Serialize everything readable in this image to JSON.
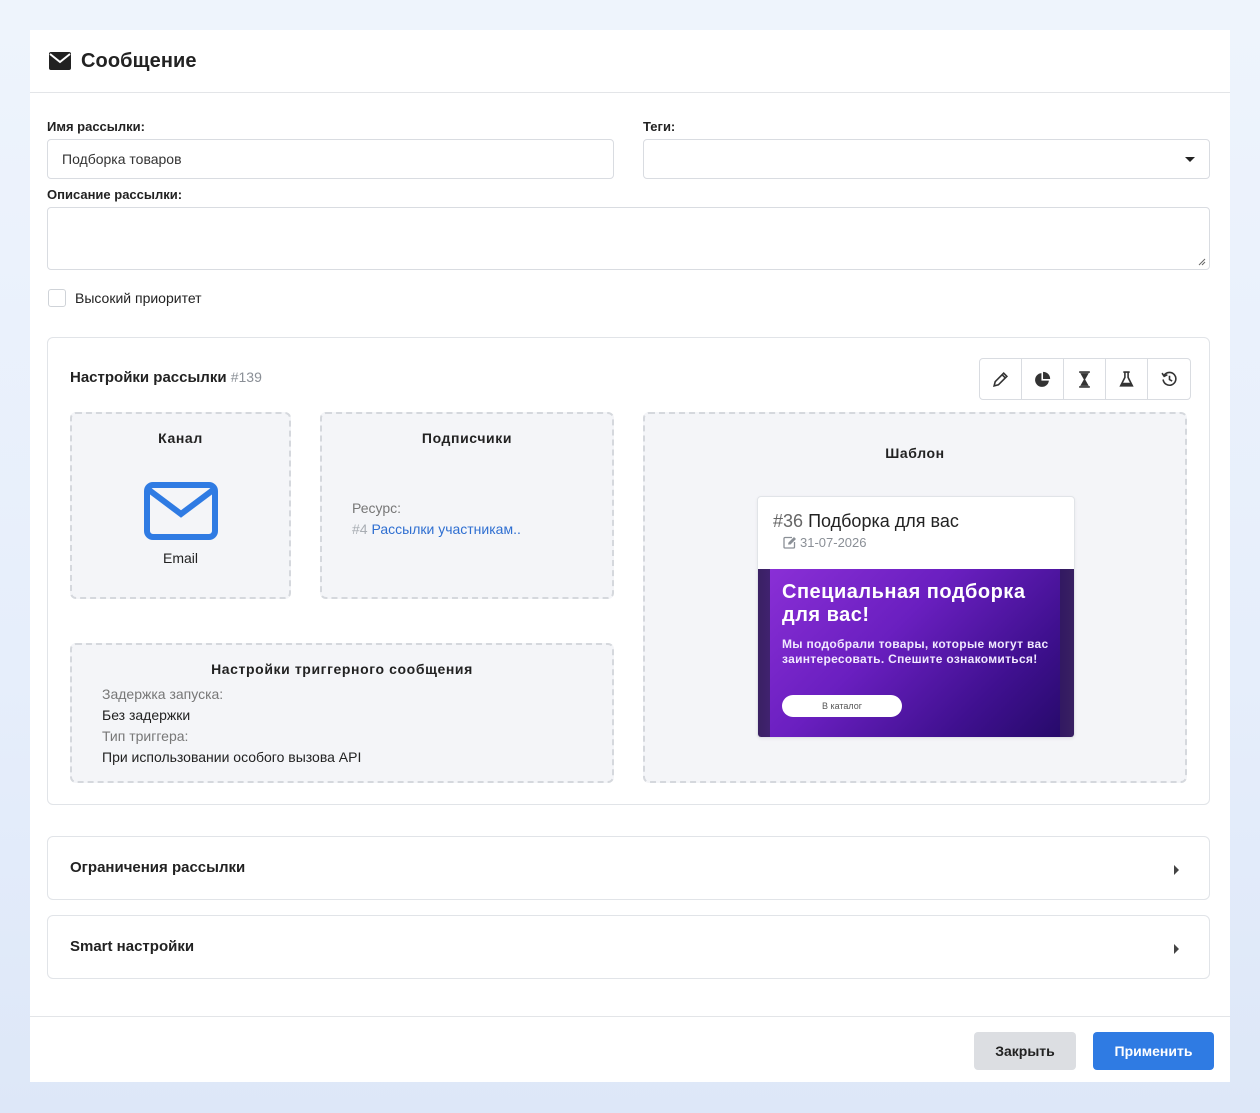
{
  "modal": {
    "title": "Сообщение",
    "title_icon": "envelope-icon"
  },
  "form": {
    "name_label": "Имя рассылки:",
    "name_value": "Подборка товаров",
    "tags_label": "Теги:",
    "tags_value": "",
    "description_label": "Описание рассылки:",
    "description_value": "",
    "priority_label": "Высокий приоритет",
    "priority_checked": false
  },
  "settings": {
    "title": "Настройки рассылки",
    "id": "#139",
    "toolbar": [
      "pencil-icon",
      "pie-chart-icon",
      "hourglass-icon",
      "flask-icon",
      "history-icon"
    ],
    "channel": {
      "title": "Канал",
      "name": "Email",
      "icon": "email-icon",
      "icon_color": "#2f7be3"
    },
    "subscribers": {
      "title": "Подписчики",
      "resource_label": "Ресурс:",
      "resource_id": "#4",
      "resource_name": "Рассылки участникам.."
    },
    "trigger": {
      "title": "Настройки триггерного сообщения",
      "delay_label": "Задержка запуска:",
      "delay_value": "Без задержки",
      "type_label": "Тип триггера:",
      "type_value": "При использовании особого вызова API"
    },
    "template": {
      "title": "Шаблон",
      "id": "#36",
      "name": "Подборка для вас",
      "date": "31-07-2026",
      "preview_heading": "Специальная подборка для вас!",
      "preview_text": "Мы подобрали товары, которые могут вас заинтересовать. Спешите ознакомиться!",
      "preview_button": "В каталог"
    }
  },
  "sections": {
    "limits_title": "Ограничения рассылки",
    "smart_title": "Smart настройки"
  },
  "footer": {
    "close_label": "Закрыть",
    "apply_label": "Применить"
  },
  "colors": {
    "accent": "#2f7be3",
    "link": "#2f6fd1"
  }
}
